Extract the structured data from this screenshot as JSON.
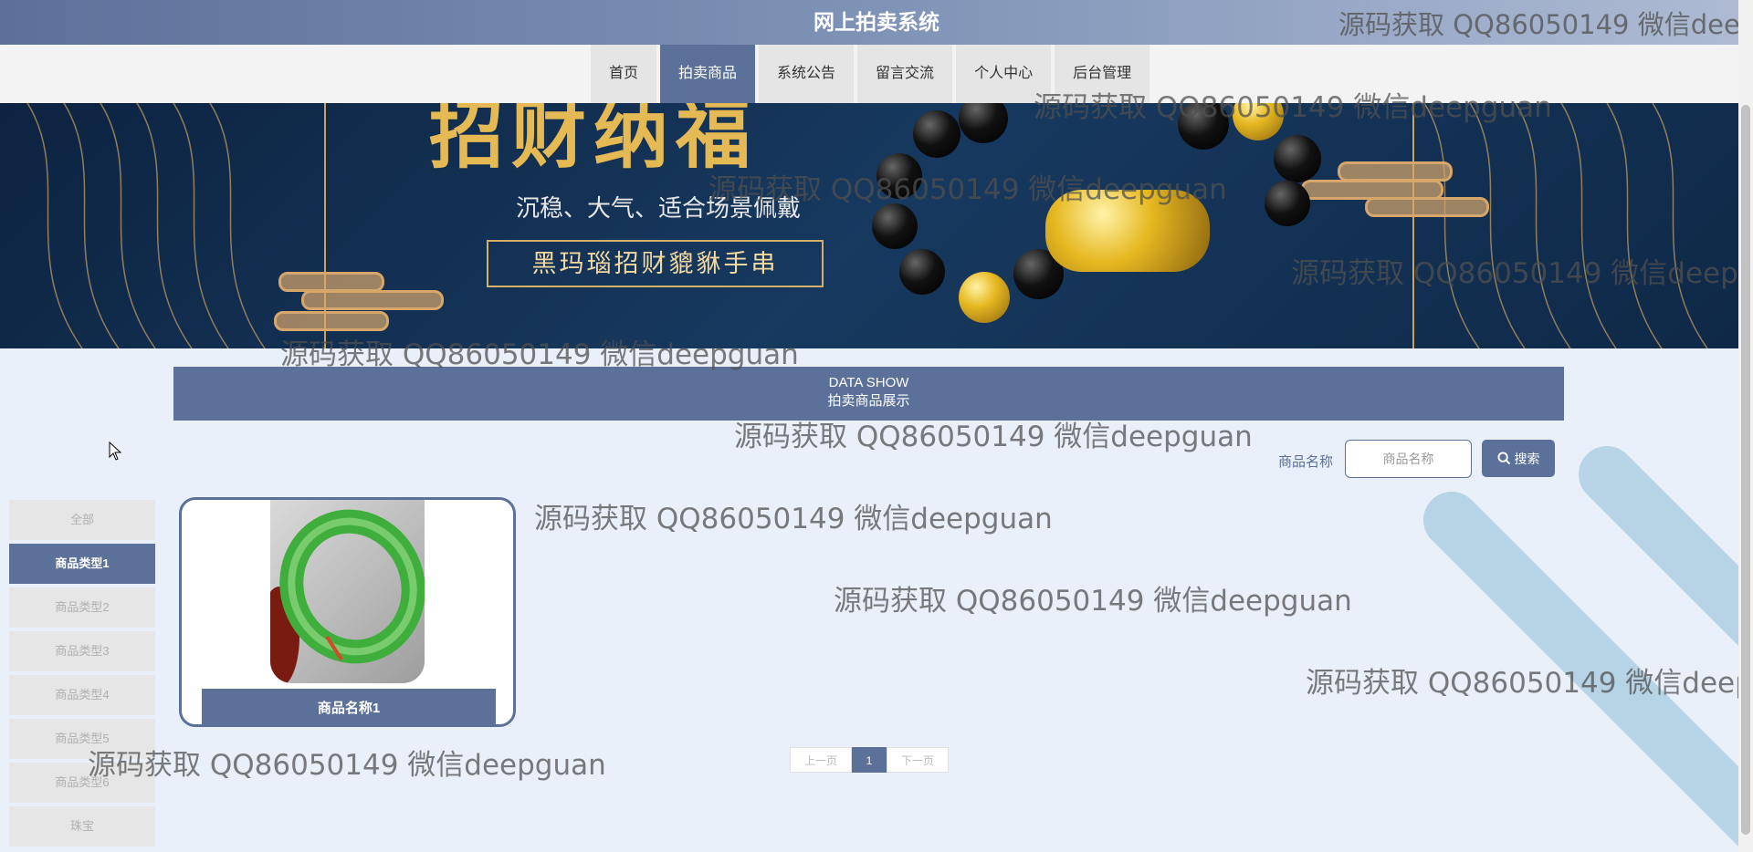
{
  "header": {
    "title": "网上拍卖系统"
  },
  "nav": {
    "items": [
      {
        "label": "首页"
      },
      {
        "label": "拍卖商品"
      },
      {
        "label": "系统公告"
      },
      {
        "label": "留言交流"
      },
      {
        "label": "个人中心"
      },
      {
        "label": "后台管理"
      }
    ],
    "active_index": 1
  },
  "banner": {
    "headline": "招财纳福",
    "subtitle": "沉稳、大气、适合场景佩戴",
    "tag": "黑玛瑙招财貔貅手串"
  },
  "section": {
    "title_en": "DATA SHOW",
    "title_cn": "拍卖商品展示"
  },
  "search": {
    "label": "商品名称",
    "placeholder": "商品名称",
    "button": "搜索"
  },
  "categories": {
    "items": [
      "全部",
      "商品类型1",
      "商品类型2",
      "商品类型3",
      "商品类型4",
      "商品类型5",
      "商品类型6",
      "珠宝"
    ],
    "active_index": 1
  },
  "products": [
    {
      "name": "商品名称1"
    }
  ],
  "pagination": {
    "prev": "上一页",
    "current": "1",
    "next": "下一页"
  },
  "watermark": "源码获取 QQ86050149 微信deepguan",
  "colors": {
    "primary": "#5c7199",
    "page_bg": "#eaf0f9",
    "deco": "#b7d3e6"
  }
}
